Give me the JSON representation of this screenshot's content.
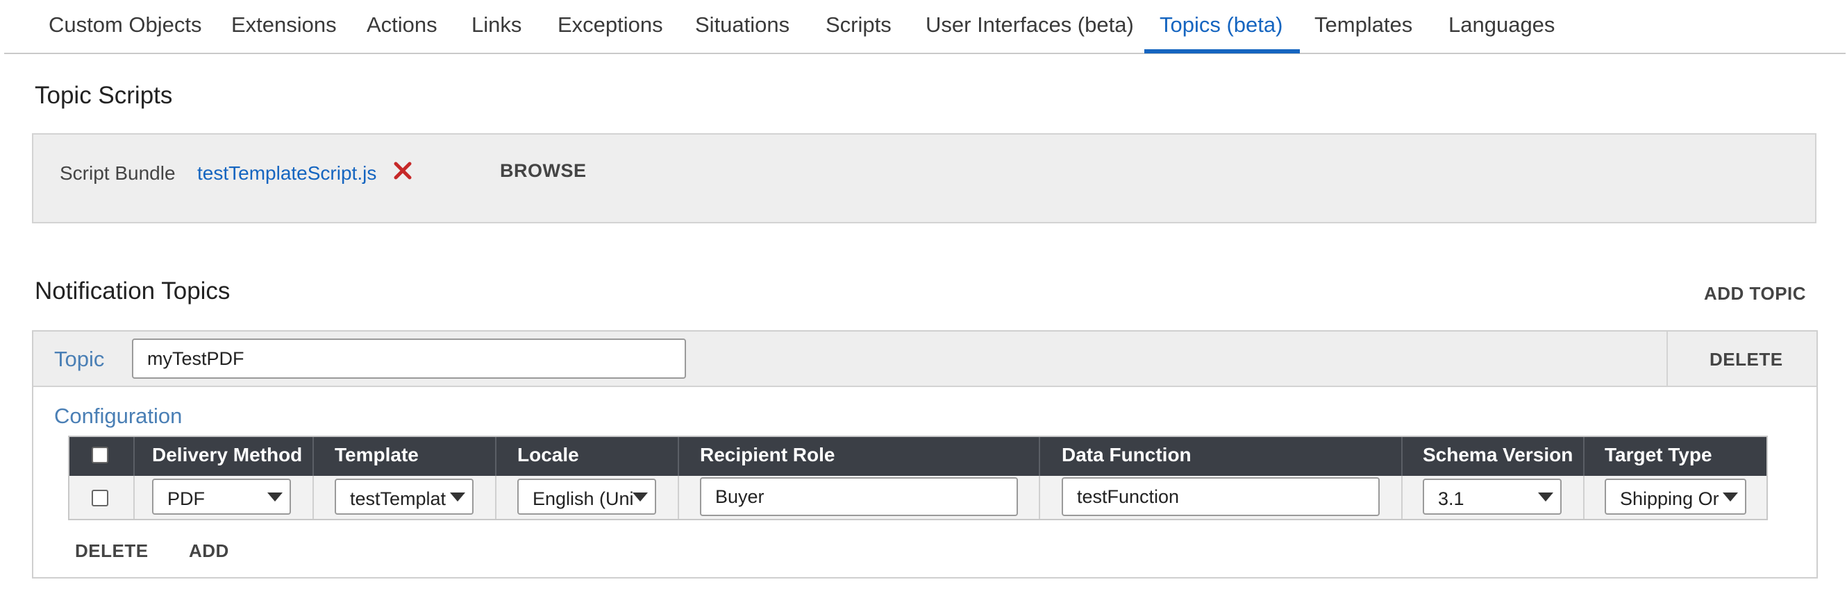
{
  "tabs": [
    {
      "label": "Custom Objects"
    },
    {
      "label": "Extensions"
    },
    {
      "label": "Actions"
    },
    {
      "label": "Links"
    },
    {
      "label": "Exceptions"
    },
    {
      "label": "Situations"
    },
    {
      "label": "Scripts"
    },
    {
      "label": "User Interfaces (beta)"
    },
    {
      "label": "Topics (beta)",
      "active": true
    },
    {
      "label": "Templates"
    },
    {
      "label": "Languages"
    }
  ],
  "topic_scripts": {
    "title": "Topic Scripts",
    "bundle_label": "Script Bundle",
    "bundle_file": "testTemplateScript.js",
    "remove_icon": "close-x-icon",
    "browse_label": "BROWSE"
  },
  "notification_topics": {
    "title": "Notification Topics",
    "add_topic_label": "ADD TOPIC",
    "topic": {
      "label": "Topic",
      "name_value": "myTestPDF",
      "delete_label": "DELETE",
      "configuration_label": "Configuration",
      "columns": [
        "Delivery Method",
        "Template",
        "Locale",
        "Recipient Role",
        "Data Function",
        "Schema Version",
        "Target Type"
      ],
      "rows": [
        {
          "delivery_method": "PDF",
          "template": "testTemplat",
          "locale": "English (Uni",
          "recipient_role": "Buyer",
          "data_function": "testFunction",
          "schema_version": "3.1",
          "target_type": "Shipping Or"
        }
      ],
      "grid_delete_label": "DELETE",
      "grid_add_label": "ADD"
    }
  },
  "colors": {
    "accent": "#1565c0",
    "section_label": "#4a7fb5",
    "grid_header": "#3b3f46",
    "remove_icon": "#c62828"
  }
}
